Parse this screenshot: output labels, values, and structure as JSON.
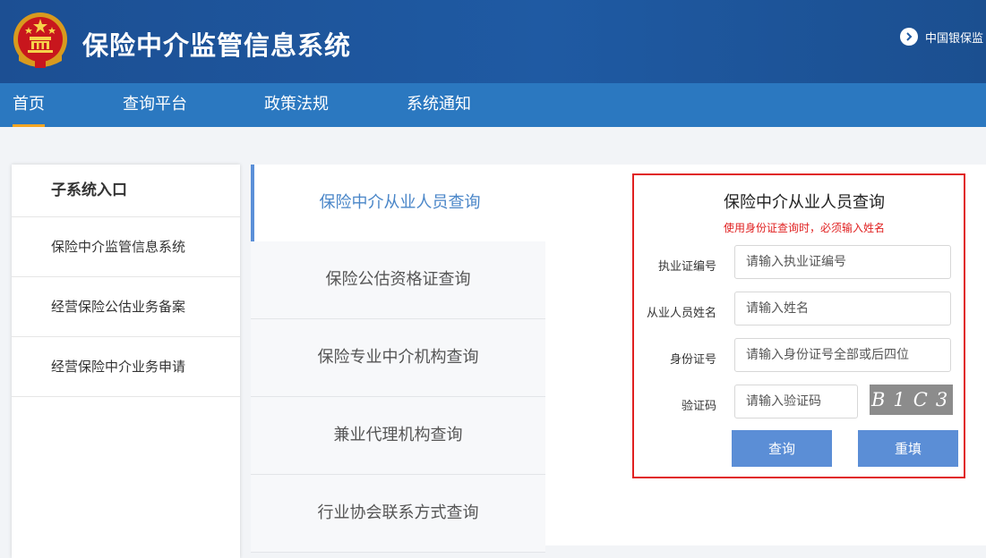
{
  "header": {
    "site_title": "保险中介监管信息系统",
    "ext_link": "中国银保监"
  },
  "nav": {
    "items": [
      "首页",
      "查询平台",
      "政策法规",
      "系统通知"
    ],
    "active_index": 0
  },
  "sidebar": {
    "title": "子系统入口",
    "items": [
      "保险中介监管信息系统",
      "经营保险公估业务备案",
      "经营保险中介业务申请"
    ]
  },
  "tabs": {
    "items": [
      "保险中介从业人员查询",
      "保险公估资格证查询",
      "保险专业中介机构查询",
      "兼业代理机构查询",
      "行业协会联系方式查询"
    ],
    "active_index": 0
  },
  "form": {
    "title": "保险中介从业人员查询",
    "note": "使用身份证查询时，必须输入姓名",
    "fields": [
      {
        "label": "执业证编号",
        "placeholder": "请输入执业证编号",
        "value": ""
      },
      {
        "label": "从业人员姓名",
        "placeholder": "请输入姓名",
        "value": ""
      },
      {
        "label": "身份证号",
        "placeholder": "请输入身份证号全部或后四位",
        "value": ""
      },
      {
        "label": "验证码",
        "placeholder": "请输入验证码",
        "value": ""
      }
    ],
    "captcha_text": "B1C3",
    "submit_label": "查询",
    "reset_label": "重填"
  },
  "colors": {
    "header_bg": "#1f5aa3",
    "nav_bg": "#2b78c0",
    "nav_active_underline": "#f5a623",
    "button_bg": "#5b8ed6",
    "alert_red": "#e02020",
    "active_tab_text": "#4a86c8"
  }
}
